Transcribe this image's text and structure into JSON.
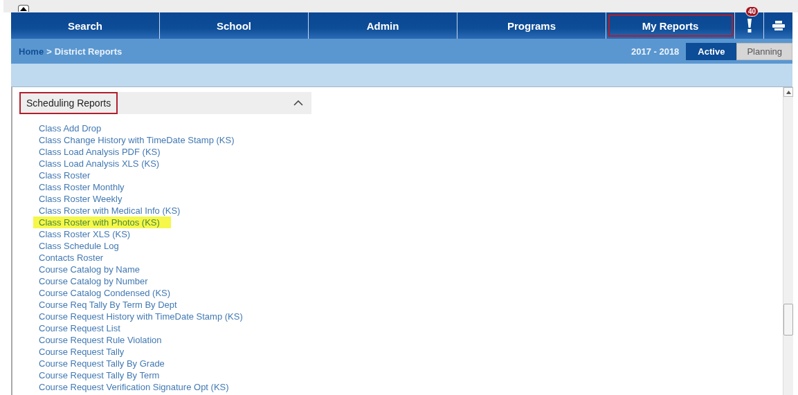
{
  "nav": {
    "tabs": [
      {
        "label": "Search",
        "outlined": false
      },
      {
        "label": "School",
        "outlined": false
      },
      {
        "label": "Admin",
        "outlined": false
      },
      {
        "label": "Programs",
        "outlined": false
      },
      {
        "label": "My Reports",
        "outlined": true
      }
    ],
    "alert_count": "40"
  },
  "breadcrumb": {
    "home": "Home",
    "separator": ">",
    "current": "District Reports"
  },
  "year": "2017 - 2018",
  "modes": [
    {
      "label": "Active",
      "selected": true
    },
    {
      "label": "Planning",
      "selected": false
    }
  ],
  "section": {
    "title": "Scheduling Reports",
    "outlined": true,
    "expanded": true
  },
  "reports": [
    {
      "label": "Class Add Drop",
      "highlighted": false
    },
    {
      "label": "Class Change History with TimeDate Stamp (KS)",
      "highlighted": false
    },
    {
      "label": "Class Load Analysis PDF (KS)",
      "highlighted": false
    },
    {
      "label": "Class Load Analysis XLS (KS)",
      "highlighted": false
    },
    {
      "label": "Class Roster",
      "highlighted": false
    },
    {
      "label": "Class Roster Monthly",
      "highlighted": false
    },
    {
      "label": "Class Roster Weekly",
      "highlighted": false
    },
    {
      "label": "Class Roster with Medical Info (KS)",
      "highlighted": false
    },
    {
      "label": "Class Roster with Photos (KS)",
      "highlighted": true
    },
    {
      "label": "Class Roster XLS (KS)",
      "highlighted": false
    },
    {
      "label": "Class Schedule Log",
      "highlighted": false
    },
    {
      "label": "Contacts Roster",
      "highlighted": false
    },
    {
      "label": "Course Catalog by Name",
      "highlighted": false
    },
    {
      "label": "Course Catalog by Number",
      "highlighted": false
    },
    {
      "label": "Course Catalog Condensed (KS)",
      "highlighted": false
    },
    {
      "label": "Course Req Tally By Term By Dept",
      "highlighted": false
    },
    {
      "label": "Course Request History with TimeDate Stamp (KS)",
      "highlighted": false
    },
    {
      "label": "Course Request List",
      "highlighted": false
    },
    {
      "label": "Course Request Rule Violation",
      "highlighted": false
    },
    {
      "label": "Course Request Tally",
      "highlighted": false
    },
    {
      "label": "Course Request Tally By Grade",
      "highlighted": false
    },
    {
      "label": "Course Request Tally By Term",
      "highlighted": false
    },
    {
      "label": "Course Request Verification Signature Opt (KS)",
      "highlighted": false
    }
  ]
}
